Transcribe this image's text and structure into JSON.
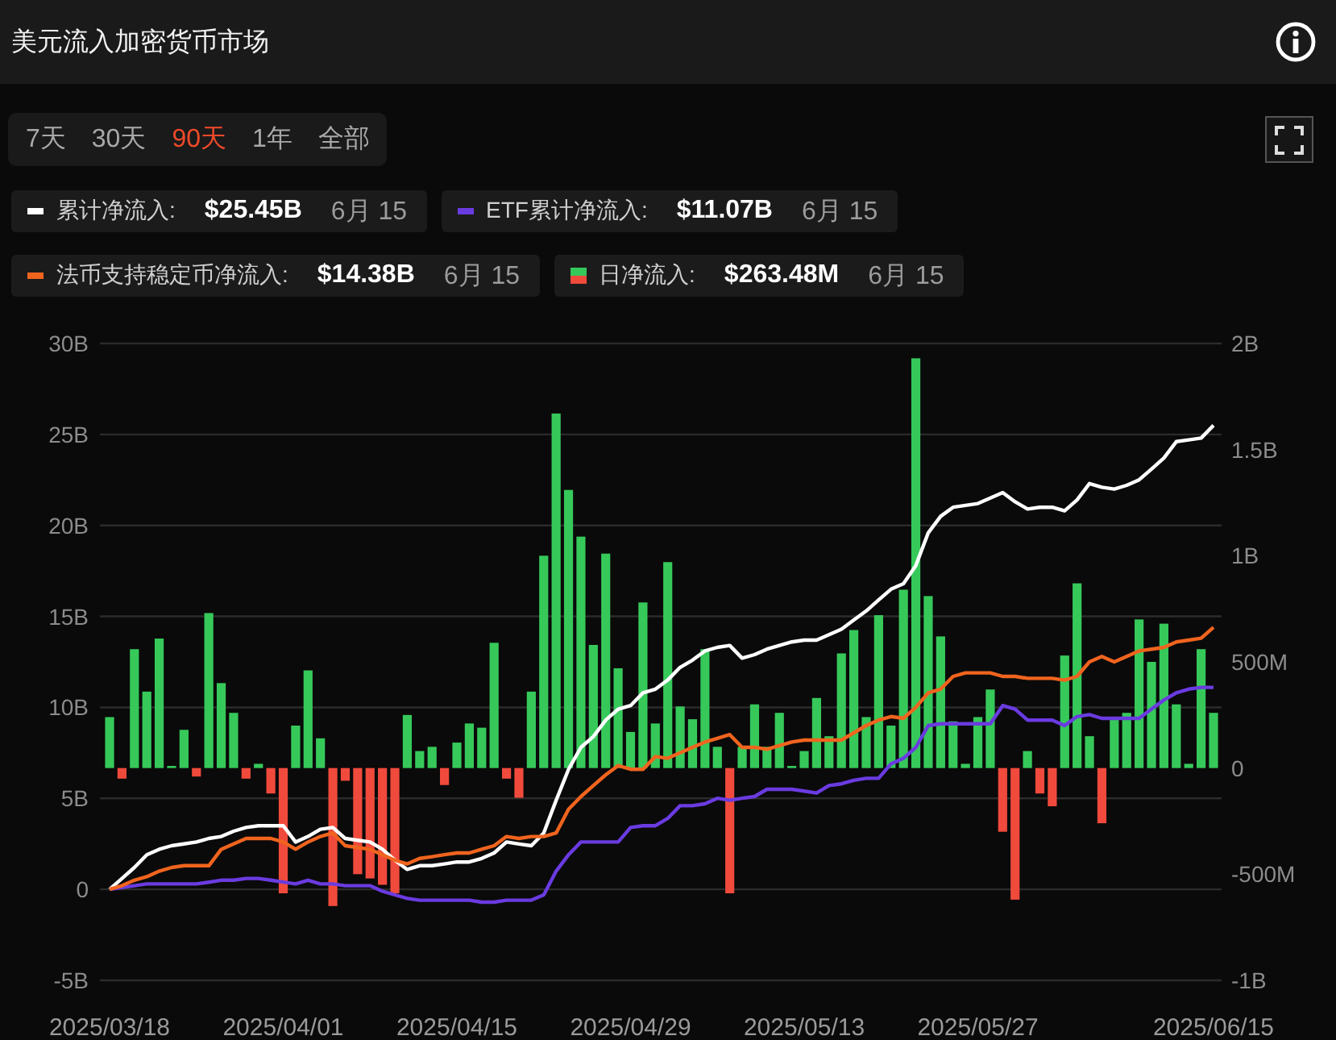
{
  "header": {
    "title": "美元流入加密货币市场"
  },
  "range_tabs": [
    {
      "label": "7天",
      "selected": false
    },
    {
      "label": "30天",
      "selected": false
    },
    {
      "label": "90天",
      "selected": true
    },
    {
      "label": "1年",
      "selected": false
    },
    {
      "label": "全部",
      "selected": false
    }
  ],
  "legend": [
    {
      "kind": "line",
      "label": "累计净流入:",
      "value": "$25.45B",
      "date": "6月 15",
      "color": "#ffffff"
    },
    {
      "kind": "line",
      "label": "ETF累计净流入:",
      "value": "$11.07B",
      "date": "6月 15",
      "color": "#6a3be0"
    },
    {
      "kind": "line",
      "label": "法币支持稳定币净流入:",
      "value": "$14.38B",
      "date": "6月 15",
      "color": "#f0641e"
    },
    {
      "kind": "split",
      "label": "日净流入:",
      "value": "$263.48M",
      "date": "6月 15"
    }
  ],
  "chart": {
    "chart_data": {
      "type": "bar",
      "categories": [
        "2025/03/18",
        null,
        null,
        null,
        null,
        null,
        null,
        null,
        null,
        null,
        null,
        null,
        null,
        null,
        "2025/04/01",
        null,
        null,
        null,
        null,
        null,
        null,
        null,
        null,
        null,
        null,
        null,
        null,
        null,
        "2025/04/15",
        null,
        null,
        null,
        null,
        null,
        null,
        null,
        null,
        null,
        null,
        null,
        null,
        null,
        "2025/04/29",
        null,
        null,
        null,
        null,
        null,
        null,
        null,
        null,
        null,
        null,
        null,
        null,
        null,
        "2025/05/13",
        null,
        null,
        null,
        null,
        null,
        null,
        null,
        null,
        null,
        null,
        null,
        null,
        null,
        "2025/05/27",
        null,
        null,
        null,
        null,
        null,
        null,
        null,
        null,
        null,
        null,
        null,
        null,
        null,
        null,
        null,
        null,
        null,
        null,
        "2025/06/15"
      ],
      "ylim": [
        -5,
        30
      ],
      "yticks": [
        {
          "value": 30,
          "label": "30B"
        },
        {
          "value": 25,
          "label": "25B"
        },
        {
          "value": 20,
          "label": "20B"
        },
        {
          "value": 15,
          "label": "15B"
        },
        {
          "value": 10,
          "label": "10B"
        },
        {
          "value": 5,
          "label": "5B"
        },
        {
          "value": 0,
          "label": "0"
        },
        {
          "value": -5,
          "label": "-5B"
        }
      ],
      "y2lim": [
        -1000000000,
        2000000000
      ],
      "y2ticks": [
        {
          "value": 2000000000,
          "label": "2B"
        },
        {
          "value": 1500000000,
          "label": "1.5B"
        },
        {
          "value": 1000000000,
          "label": "1B"
        },
        {
          "value": 500000000,
          "label": "500M"
        },
        {
          "value": 0,
          "label": "0"
        },
        {
          "value": -500000000,
          "label": "-500M"
        },
        {
          "value": -1000000000,
          "label": "-1B"
        }
      ],
      "grid": true,
      "series": [
        {
          "type": "line",
          "color": "#ffffff",
          "values": [
            0,
            0.6,
            1.2,
            1.9,
            2.2,
            2.4,
            2.5,
            2.6,
            2.8,
            2.9,
            3.2,
            3.4,
            3.5,
            3.5,
            3.5,
            2.6,
            2.9,
            3.3,
            3.4,
            2.8,
            2.7,
            2.6,
            2.2,
            1.6,
            1.1,
            1.3,
            1.3,
            1.4,
            1.5,
            1.5,
            1.7,
            2.0,
            2.6,
            2.5,
            2.4,
            3.1,
            4.9,
            6.6,
            7.8,
            8.4,
            9.3,
            9.9,
            10.1,
            10.8,
            11.0,
            11.5,
            12.2,
            12.6,
            13.1,
            13.3,
            13.4,
            12.7,
            12.9,
            13.2,
            13.4,
            13.6,
            13.7,
            13.7,
            14.0,
            14.3,
            14.8,
            15.3,
            15.9,
            16.5,
            16.8,
            17.8,
            19.6,
            20.5,
            21.0,
            21.1,
            21.2,
            21.5,
            21.8,
            21.3,
            20.9,
            21.0,
            21.0,
            20.8,
            21.4,
            22.3,
            22.1,
            22.0,
            22.2,
            22.5,
            23.1,
            23.7,
            24.6,
            24.7,
            24.8,
            25.5
          ]
        },
        {
          "type": "line",
          "color": "#6a3be0",
          "values": [
            0,
            0.1,
            0.2,
            0.3,
            0.3,
            0.3,
            0.3,
            0.3,
            0.4,
            0.5,
            0.5,
            0.6,
            0.6,
            0.5,
            0.4,
            0.3,
            0.5,
            0.3,
            0.3,
            0.2,
            0.2,
            0.2,
            -0.1,
            -0.3,
            -0.5,
            -0.6,
            -0.6,
            -0.6,
            -0.6,
            -0.6,
            -0.7,
            -0.7,
            -0.6,
            -0.6,
            -0.6,
            -0.3,
            1.0,
            1.9,
            2.6,
            2.6,
            2.6,
            2.6,
            3.4,
            3.5,
            3.5,
            3.9,
            4.6,
            4.6,
            4.7,
            5.0,
            4.9,
            5.0,
            5.1,
            5.5,
            5.5,
            5.5,
            5.4,
            5.3,
            5.7,
            5.8,
            6.0,
            6.1,
            6.1,
            6.9,
            7.2,
            7.8,
            9.0,
            9.1,
            9.1,
            9.1,
            9.1,
            9.1,
            10.1,
            9.9,
            9.3,
            9.3,
            9.3,
            9.0,
            9.5,
            9.6,
            9.4,
            9.4,
            9.4,
            9.4,
            9.9,
            10.4,
            10.8,
            11.0,
            11.1,
            11.1
          ]
        },
        {
          "type": "line",
          "color": "#f0641e",
          "values": [
            0,
            0.2,
            0.5,
            0.7,
            1.0,
            1.2,
            1.3,
            1.3,
            1.3,
            2.2,
            2.5,
            2.8,
            2.8,
            2.8,
            2.6,
            2.2,
            2.6,
            2.9,
            3.1,
            2.4,
            2.3,
            2.2,
            1.9,
            1.6,
            1.4,
            1.7,
            1.8,
            1.9,
            2.0,
            2.0,
            2.2,
            2.4,
            2.9,
            2.8,
            2.9,
            2.9,
            3.1,
            4.4,
            5.1,
            5.7,
            6.3,
            6.8,
            6.6,
            6.6,
            7.3,
            7.2,
            7.5,
            7.8,
            8.1,
            8.3,
            8.5,
            7.8,
            7.8,
            7.7,
            7.9,
            8.1,
            8.2,
            8.2,
            8.2,
            8.2,
            8.6,
            9.0,
            9.3,
            9.5,
            9.4,
            10.0,
            10.8,
            11.0,
            11.7,
            11.9,
            11.9,
            11.9,
            11.7,
            11.7,
            11.6,
            11.6,
            11.6,
            11.5,
            11.7,
            12.5,
            12.8,
            12.5,
            12.8,
            13.1,
            13.2,
            13.3,
            13.6,
            13.7,
            13.8,
            14.4
          ]
        },
        {
          "type": "bar",
          "axis": "y2",
          "color": "#36c95a",
          "values": [
            240000000,
            null,
            560000000,
            360000000,
            610000000,
            10000000,
            180000000,
            null,
            730000000,
            400000000,
            260000000,
            null,
            20000000,
            null,
            null,
            200000000,
            460000000,
            140000000,
            null,
            null,
            null,
            null,
            null,
            null,
            250000000,
            80000000,
            100000000,
            null,
            120000000,
            210000000,
            190000000,
            590000000,
            null,
            null,
            360000000,
            1000000000,
            1670000000,
            1310000000,
            1090000000,
            580000000,
            1010000000,
            470000000,
            170000000,
            780000000,
            210000000,
            970000000,
            290000000,
            230000000,
            560000000,
            100000000,
            null,
            100000000,
            300000000,
            100000000,
            260000000,
            10000000,
            80000000,
            330000000,
            150000000,
            540000000,
            650000000,
            240000000,
            720000000,
            200000000,
            840000000,
            1930000000,
            810000000,
            620000000,
            220000000,
            20000000,
            240000000,
            370000000,
            null,
            null,
            80000000,
            null,
            null,
            530000000,
            870000000,
            150000000,
            null,
            240000000,
            260000000,
            700000000,
            500000000,
            680000000,
            300000000,
            20000000,
            560000000,
            260000000
          ]
        },
        {
          "type": "bar",
          "axis": "y2",
          "color": "#f04a3c",
          "values": [
            null,
            -50000000,
            null,
            null,
            null,
            null,
            null,
            -40000000,
            null,
            null,
            null,
            -50000000,
            null,
            -120000000,
            -590000000,
            null,
            null,
            null,
            -650000000,
            -60000000,
            -500000000,
            -520000000,
            -550000000,
            -590000000,
            null,
            null,
            null,
            -80000000,
            null,
            null,
            null,
            null,
            -50000000,
            -140000000,
            null,
            null,
            null,
            null,
            null,
            null,
            null,
            null,
            null,
            null,
            null,
            null,
            null,
            null,
            null,
            null,
            -590000000,
            null,
            null,
            null,
            null,
            null,
            null,
            null,
            null,
            null,
            null,
            null,
            null,
            null,
            null,
            null,
            null,
            null,
            null,
            null,
            null,
            null,
            -300000000,
            -620000000,
            null,
            -120000000,
            -180000000,
            null,
            null,
            null,
            -260000000,
            null,
            null,
            null,
            null,
            null,
            null,
            null,
            null,
            null
          ]
        }
      ]
    }
  }
}
